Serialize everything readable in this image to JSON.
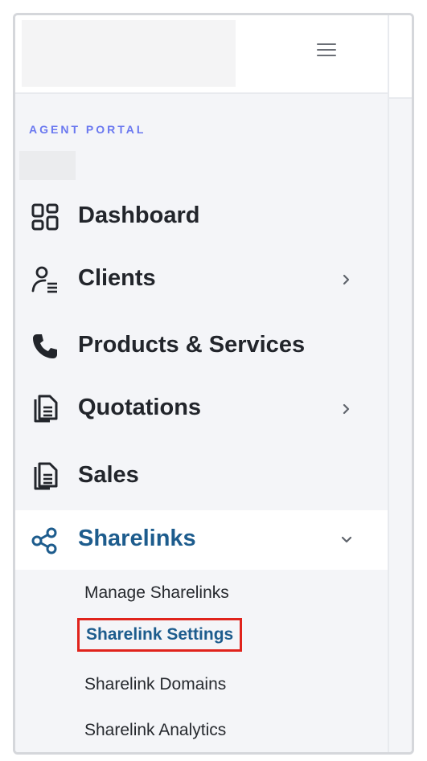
{
  "colors": {
    "accent": "#1d5c8d",
    "section_label": "#6a78f0",
    "highlight_border": "#e0231c"
  },
  "header": {
    "menu_icon": "hamburger-menu-icon"
  },
  "sidebar": {
    "section_label": "AGENT PORTAL",
    "items": [
      {
        "label": "Dashboard",
        "icon": "dashboard-grid-icon",
        "has_chevron": false
      },
      {
        "label": "Clients",
        "icon": "user-list-icon",
        "has_chevron": true
      },
      {
        "label": "Products & Services",
        "icon": "phone-icon",
        "has_chevron": false
      },
      {
        "label": "Quotations",
        "icon": "document-icon",
        "has_chevron": true
      },
      {
        "label": "Sales",
        "icon": "document-icon",
        "has_chevron": false
      },
      {
        "label": "Sharelinks",
        "icon": "share-icon",
        "has_chevron": true,
        "expanded": true,
        "active": true
      }
    ],
    "submenu": [
      {
        "label": "Manage Sharelinks"
      },
      {
        "label": "Sharelink Settings",
        "selected": true
      },
      {
        "label": "Sharelink Domains"
      },
      {
        "label": "Sharelink Analytics"
      }
    ]
  }
}
